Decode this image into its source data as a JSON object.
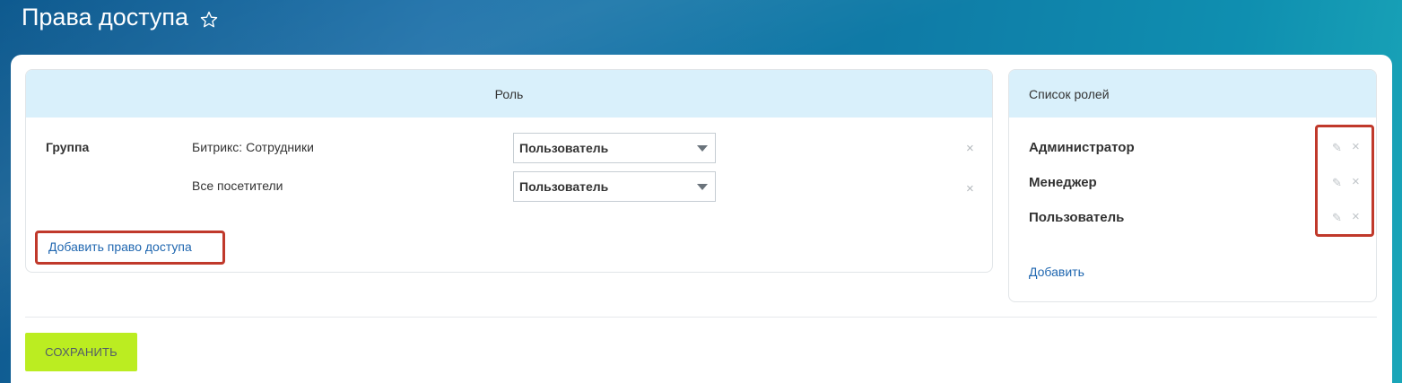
{
  "header": {
    "title": "Права доступа",
    "star_icon": "star-outline-icon"
  },
  "role_panel": {
    "heading": "Роль",
    "rows": [
      {
        "group_label": "Группа",
        "entity": "Битрикс: Сотрудники",
        "role": "Пользователь"
      },
      {
        "group_label": "",
        "entity": "Все посетители",
        "role": "Пользователь"
      }
    ],
    "remove_symbol": "×",
    "add_access_label": "Добавить право доступа"
  },
  "roles_panel": {
    "heading": "Список ролей",
    "roles": [
      "Администратор",
      "Менеджер",
      "Пользователь"
    ],
    "edit_symbol": "✎",
    "delete_symbol": "×",
    "add_label": "Добавить"
  },
  "footer": {
    "save_label": "СОХРАНИТЬ"
  },
  "colors": {
    "accent_green": "#bbed21",
    "link_blue": "#2067b0",
    "highlight_red": "#c0392b",
    "panel_header": "#d9f0fb"
  }
}
